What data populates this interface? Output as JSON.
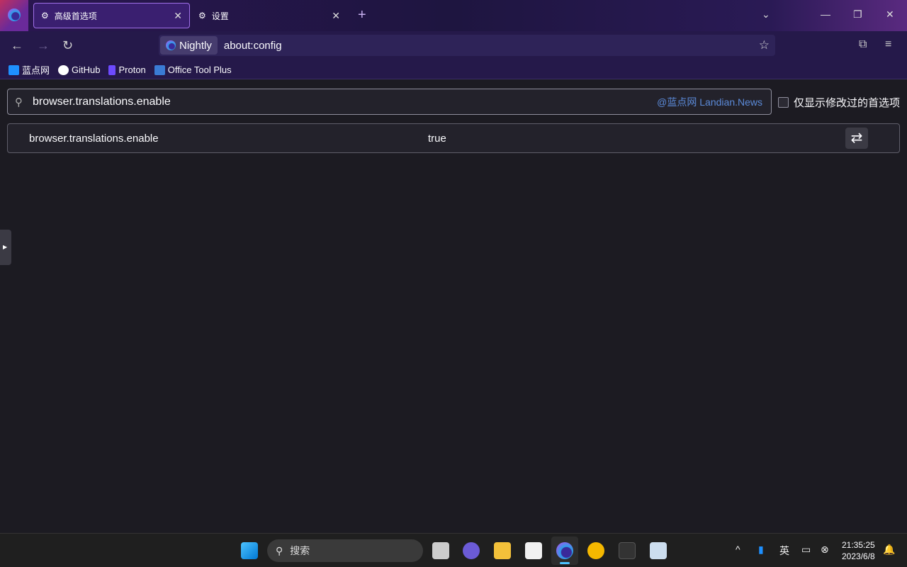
{
  "tabs": [
    {
      "label": "高级首选项",
      "icon": "gear-icon",
      "active": true
    },
    {
      "label": "设置",
      "icon": "gear-icon",
      "active": false
    }
  ],
  "nav": {
    "identity": "Nightly",
    "url": "about:config"
  },
  "bookmarks": [
    {
      "label": "蓝点网",
      "color": "#1e90ff"
    },
    {
      "label": "GitHub",
      "color": "#ffffff"
    },
    {
      "label": "Proton",
      "color": "#6d4aff"
    },
    {
      "label": "Office Tool Plus",
      "color": "#3a7bd5"
    }
  ],
  "config": {
    "search_value": "browser.translations.enable",
    "watermark": "@蓝点网 Landian.News",
    "modified_only_label": "仅显示修改过的首选项",
    "modified_only_checked": false,
    "rows": [
      {
        "name": "browser.translations.enable",
        "value": "true"
      }
    ]
  },
  "taskbar": {
    "search_label": "搜索",
    "ime": "英",
    "time": "21:35:25",
    "date": "2023/6/8"
  }
}
